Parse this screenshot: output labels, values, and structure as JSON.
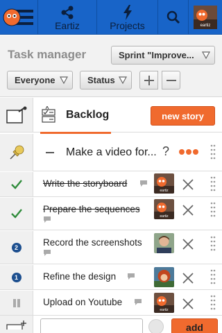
{
  "nav": {
    "eartiz_label": "Eartiz",
    "projects_label": "Projects",
    "user_tag": "eartiz"
  },
  "header": {
    "title": "Task manager",
    "sprint_selected": "Sprint \"Improve...",
    "assignee_selected": "Everyone",
    "status_selected": "Status"
  },
  "backlog": {
    "title": "Backlog",
    "new_story_label": "new story"
  },
  "story": {
    "title": "Make a video for...",
    "help_mark": "?"
  },
  "tasks": [
    {
      "label": "Write the storyboard",
      "status": "done",
      "owner": "eartiz"
    },
    {
      "label": "Prepare the sequences",
      "status": "done",
      "owner": "eartiz"
    },
    {
      "label": "Record the screenshots",
      "status": "2",
      "owner": "person"
    },
    {
      "label": "Refine the design",
      "status": "1",
      "owner": "redhead"
    },
    {
      "label": "Upload on Youtube",
      "status": "paused",
      "owner": "eartiz"
    }
  ],
  "add_task": {
    "placeholder": "",
    "add_label": "add"
  },
  "colors": {
    "nav_blue": "#1864c8",
    "accent_orange": "#f06a2e",
    "check_green": "#2e8b3a",
    "status_blue": "#1d4f8f"
  },
  "icons": {
    "menu": "logo-menu-icon",
    "share": "share-icon",
    "projects": "lightning-icon",
    "search": "search-icon",
    "pin": "pushpin-icon",
    "story_card": "story-card-icon",
    "backlog": "checklist-icon",
    "task_done": "checkmark-icon",
    "task_paused": "pause-icon",
    "comment": "comment-bubble-icon",
    "delete": "close-icon",
    "drag": "drag-handle-icon"
  }
}
